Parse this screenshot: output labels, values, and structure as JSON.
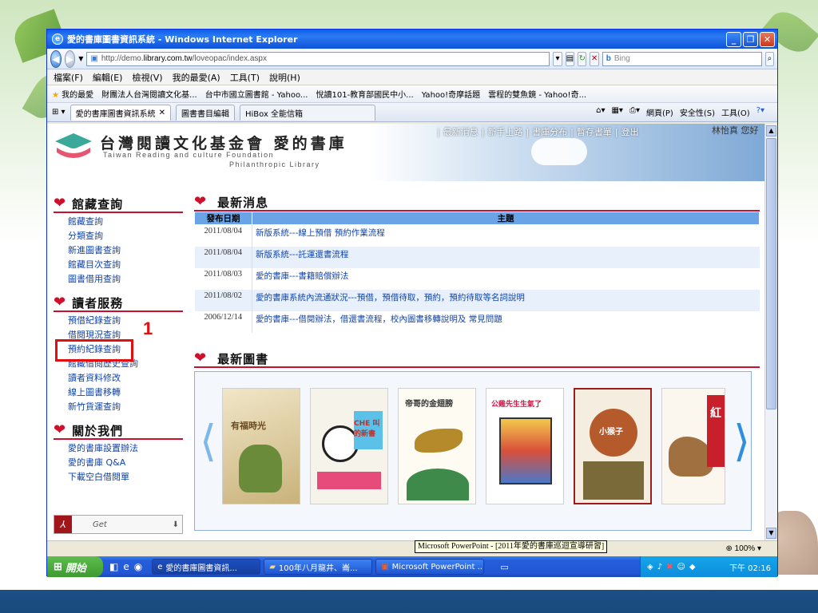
{
  "window": {
    "title": "愛的書庫圖書資訊系統 - Windows Internet Explorer",
    "url_prefix": "http://demo.",
    "url_domain": "library.com.tw",
    "url_path": "/loveopac/index.aspx",
    "search_placeholder": "Bing"
  },
  "menu": [
    "檔案(F)",
    "編輯(E)",
    "檢視(V)",
    "我的最愛(A)",
    "工具(T)",
    "說明(H)"
  ],
  "favorites": {
    "label": "我的最愛",
    "items": [
      "財團法人台灣閱讀文化基...",
      "台中市國立圖書館 - Yahoo...",
      "悅讀101-教育部國民中小...",
      "Yahoo!奇摩話題",
      "雲程的雙魚鏡 - Yahoo!奇..."
    ]
  },
  "tabs": [
    "愛的書庫圖書資訊系統",
    "圖書書目編輯",
    "HiBox 全能信箱"
  ],
  "tab_tools": [
    "網頁(P)",
    "安全性(S)",
    "工具(O)"
  ],
  "site": {
    "title": "台灣閱讀文化基金會  愛的書庫",
    "en1": "Taiwan Reading and culture Foundation",
    "en2": "Philanthropic Library",
    "top_links": [
      "最新消息",
      "新手上路",
      "書庫分布",
      "暫存書單",
      "登出"
    ],
    "user": "林怡真 您好"
  },
  "leftnav": [
    {
      "head": "館藏查詢",
      "items": [
        "館藏查詢",
        "分類查詢",
        "新進圖書查詢",
        "館藏目次查詢",
        "圖書借用查詢"
      ]
    },
    {
      "head": "讀者服務",
      "items": [
        "預借紀錄查詢",
        "借閱現況查詢",
        "預約紀錄查詢",
        "館藏借閱歷史查詢",
        "讀者資料修改",
        "線上圖書移轉",
        "新竹貨運查詢"
      ]
    },
    {
      "head": "關於我們",
      "items": [
        "愛的書庫設置辦法",
        "愛的書庫 Q&A",
        "下載空白借閱單"
      ]
    }
  ],
  "annotation_number": "1",
  "get_label": "Get",
  "news": {
    "title": "最新消息",
    "col_date": "發布日期",
    "col_subject": "主題",
    "rows": [
      {
        "date": "2011/08/04",
        "subject": "新版系統---線上預借 預約作業流程"
      },
      {
        "date": "2011/08/04",
        "subject": "新版系統---託運還書流程"
      },
      {
        "date": "2011/08/03",
        "subject": "愛的書庫---書籍賠償辦法"
      },
      {
        "date": "2011/08/02",
        "subject": "愛的書庫系統內流通狀況---預借，預借待取，預約，預約待取等名詞說明"
      },
      {
        "date": "2006/12/14",
        "subject": "愛的書庫---借閱辦法，借還書流程，校內圖書移轉說明及 常見問題"
      }
    ]
  },
  "books": {
    "title": "最新圖書",
    "covers": [
      "有福時光",
      "CHE 叫的新書",
      "帝哥的金翅膀",
      "公雞先生生氣了",
      "小猴子",
      "紅"
    ]
  },
  "status": {
    "tip": "Microsoft PowerPoint - [2011年愛的書庫巡迴宣導研習]",
    "zoom": "100%"
  },
  "taskbar": {
    "start": "開始",
    "tasks": [
      "愛的書庫圖書資訊...",
      "100年八月龍井、崙...",
      "Microsoft PowerPoint ..."
    ],
    "clock": "下午 02:16"
  },
  "colors": {
    "accent_red": "#c8102e",
    "link_blue": "#1144aa",
    "table_header": "#6aa4e6"
  }
}
